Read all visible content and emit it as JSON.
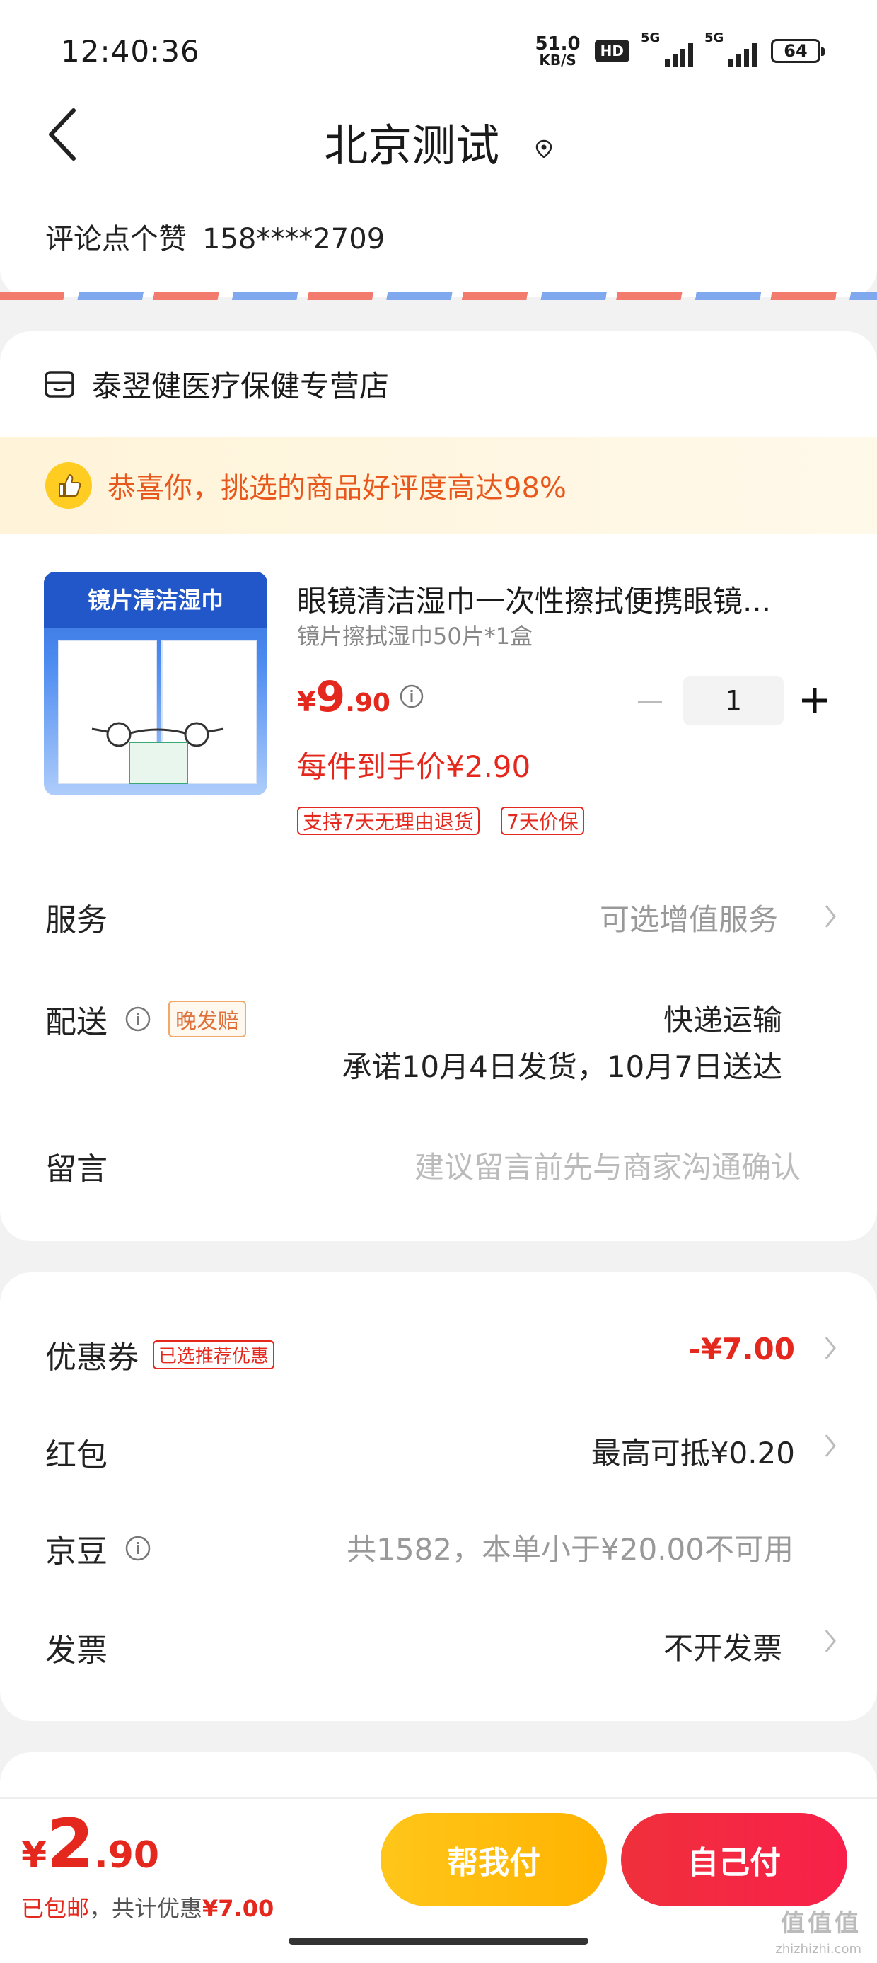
{
  "status_bar": {
    "time": "12:40:36",
    "net_speed": "51.0",
    "net_unit": "KB/S",
    "hd": "HD",
    "sig1": "5G",
    "sig2": "5G",
    "battery": "64"
  },
  "header": {
    "title": "北京测试",
    "address_name": "评论点个赞",
    "address_phone": "158****2709"
  },
  "shop": {
    "name": "泰翌健医疗保健专营店",
    "banner": "恭喜你，挑选的商品好评度高达98%"
  },
  "product": {
    "image_label": "镜片清洁湿巾",
    "title": "眼镜清洁湿巾一次性擦拭便携眼镜...",
    "spec": "镜片擦拭湿巾50片*1盒",
    "price_symbol": "¥",
    "price_int": "9",
    "price_dec": ".90",
    "quantity": "1",
    "unit_price": "每件到手价¥2.90",
    "tags": [
      "支持7天无理由退货",
      "7天价保"
    ]
  },
  "service": {
    "label": "服务",
    "value": "可选增值服务"
  },
  "delivery": {
    "label": "配送",
    "badge": "晚发赔",
    "method": "快递运输",
    "promise": "承诺10月4日发货，10月7日送达"
  },
  "message": {
    "label": "留言",
    "placeholder": "建议留言前先与商家沟通确认"
  },
  "coupon": {
    "label": "优惠券",
    "badge": "已选推荐优惠",
    "value": "-¥7.00"
  },
  "redpacket": {
    "label": "红包",
    "value": "最高可抵¥0.20"
  },
  "jingdou": {
    "label": "京豆",
    "value": "共1582，本单小于¥20.00不可用"
  },
  "invoice": {
    "label": "发票",
    "value": "不开发票"
  },
  "footer": {
    "symbol": "¥",
    "total_int": "2",
    "total_dec": ".90",
    "shipping": "已包邮",
    "discount_prefix": "，共计优惠",
    "discount": "¥7.00",
    "help_pay": "帮我付",
    "self_pay": "自己付",
    "watermark": "值值值",
    "watermark_url": "zhizhizhi.com"
  },
  "colors": {
    "accent_red": "#e5281d",
    "help_btn": "#ffc21a",
    "self_btn": "#f0303b"
  }
}
